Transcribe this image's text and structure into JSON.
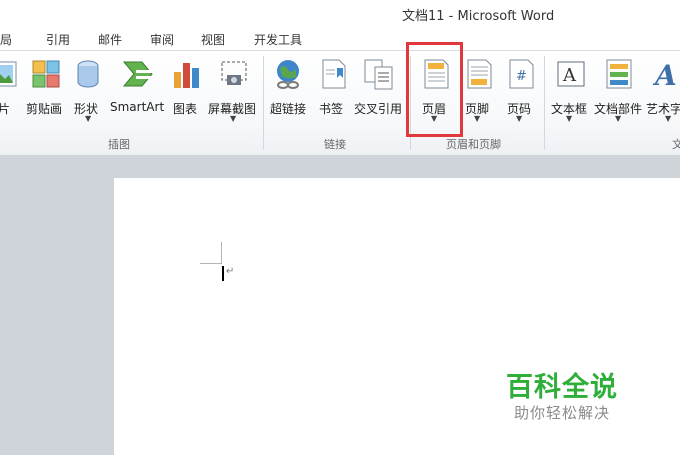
{
  "window": {
    "title": "文档11  -  Microsoft Word"
  },
  "tabs": [
    "布局",
    "引用",
    "邮件",
    "审阅",
    "视图",
    "开发工具"
  ],
  "ribbon": {
    "buttons": [
      {
        "label": "图片",
        "icon": "picture-icon",
        "dropdown": false
      },
      {
        "label": "剪贴画",
        "icon": "clipart-icon",
        "dropdown": false
      },
      {
        "label": "形状",
        "icon": "shapes-icon",
        "dropdown": true
      },
      {
        "label": "SmartArt",
        "icon": "smartart-icon",
        "dropdown": false
      },
      {
        "label": "图表",
        "icon": "chart-icon",
        "dropdown": false
      },
      {
        "label": "屏幕截图",
        "icon": "screenshot-icon",
        "dropdown": true
      },
      {
        "label": "超链接",
        "icon": "hyperlink-icon",
        "dropdown": false
      },
      {
        "label": "书签",
        "icon": "bookmark-icon",
        "dropdown": false
      },
      {
        "label": "交叉引用",
        "icon": "cross-reference-icon",
        "dropdown": false
      },
      {
        "label": "页眉",
        "icon": "header-icon",
        "dropdown": true
      },
      {
        "label": "页脚",
        "icon": "footer-icon",
        "dropdown": true
      },
      {
        "label": "页码",
        "icon": "page-number-icon",
        "dropdown": true
      },
      {
        "label": "文本框",
        "icon": "textbox-icon",
        "dropdown": true
      },
      {
        "label": "文档部件",
        "icon": "quickparts-icon",
        "dropdown": true
      },
      {
        "label": "艺术字",
        "icon": "wordart-icon",
        "dropdown": true
      }
    ],
    "groups": [
      "插图",
      "链接",
      "页眉和页脚",
      "文"
    ]
  },
  "colors": {
    "highlight": "#e0383b",
    "workspace": "#cfd4da",
    "watermark_green": "#2fae3a"
  },
  "watermark": {
    "brand": "百科全说",
    "slogan": "助你轻松解决"
  }
}
